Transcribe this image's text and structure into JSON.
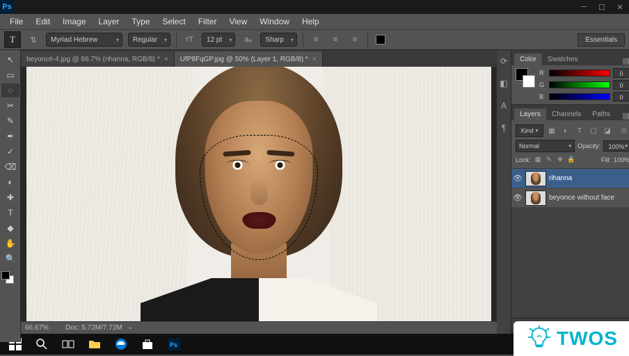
{
  "titlebar": {
    "logo": "Ps"
  },
  "menubar": [
    "File",
    "Edit",
    "Image",
    "Layer",
    "Type",
    "Select",
    "Filter",
    "View",
    "Window",
    "Help"
  ],
  "optionsbar": {
    "tool_glyph": "T",
    "font_family": "Myriad Hebrew",
    "font_style": "Regular",
    "font_size": "12 pt",
    "anti_alias": "Sharp",
    "workspace": "Essentials"
  },
  "tabs": [
    {
      "label": "beyoncé-4.jpg @ 66.7% (rihanna, RGB/8) *",
      "active": false
    },
    {
      "label": "UfP8FqGP.jpg @ 50% (Layer 1, RGB/8) *",
      "active": true
    }
  ],
  "tools": [
    "↖",
    "▭",
    "◌",
    "✂",
    "✎",
    "✒",
    "✓",
    "⌫",
    "◐",
    "✚",
    "T",
    "◆",
    "✋",
    "🔍"
  ],
  "color_panel": {
    "tabs": [
      "Color",
      "Swatches"
    ],
    "channels": [
      {
        "label": "R",
        "value": "0"
      },
      {
        "label": "G",
        "value": "0"
      },
      {
        "label": "B",
        "value": "0"
      }
    ]
  },
  "layers_panel": {
    "tabs": [
      "Layers",
      "Channels",
      "Paths"
    ],
    "kind": "Kind",
    "blend_mode": "Normal",
    "opacity_label": "Opacity:",
    "opacity_value": "100%",
    "lock_label": "Lock:",
    "fill_label": "Fill:",
    "fill_value": "100%",
    "layers": [
      {
        "name": "rihanna",
        "visible": true,
        "active": true
      },
      {
        "name": "beyonce without face",
        "visible": true,
        "active": false
      }
    ]
  },
  "statusbar": {
    "zoom": "66.67%",
    "doc_info": "Doc: 5.72M/7.72M"
  },
  "watermark": {
    "text": "TWOS"
  }
}
